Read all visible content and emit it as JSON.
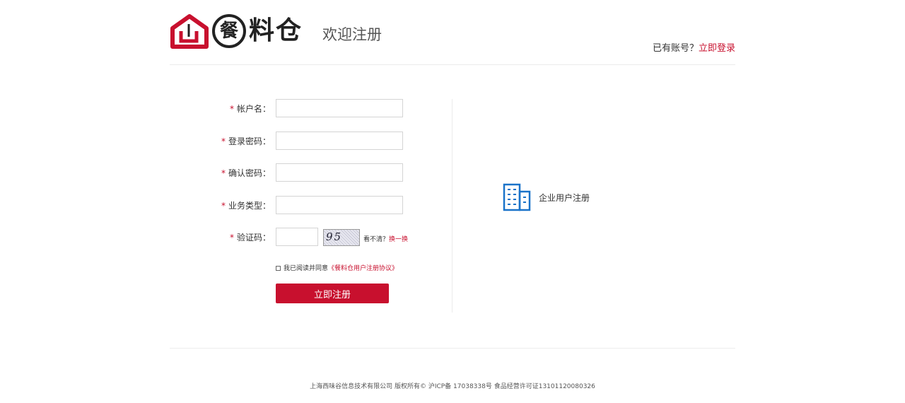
{
  "header": {
    "logo_text": "料仓",
    "logo_circle_char": "餐",
    "welcome": "欢迎注册",
    "have_account": "已有账号？",
    "login_link": "立即登录"
  },
  "form": {
    "required_mark": "*",
    "fields": [
      {
        "label": "帐户名：",
        "value": ""
      },
      {
        "label": "登录密码：",
        "value": ""
      },
      {
        "label": "确认密码：",
        "value": ""
      },
      {
        "label": "业务类型：",
        "value": ""
      },
      {
        "label": "验证码：",
        "value": ""
      }
    ],
    "captcha_text": "95 29",
    "refresh_prefix": "看不清？",
    "refresh_link": "换一换",
    "agree_text": "我已阅读并同意",
    "agree_link": "《餐料仓用户注册协议》",
    "agree_checked": false,
    "submit_label": "立即注册"
  },
  "enterprise": {
    "label": "企业用户注册",
    "icon": "building-icon"
  },
  "footer": {
    "text": "上海西味谷信息技术有限公司  版权所有© 沪ICP备 17038338号  食品经营许可证13101120080326"
  },
  "colors": {
    "brand_red": "#c8102e",
    "enterprise_icon_blue": "#1a73c9"
  }
}
